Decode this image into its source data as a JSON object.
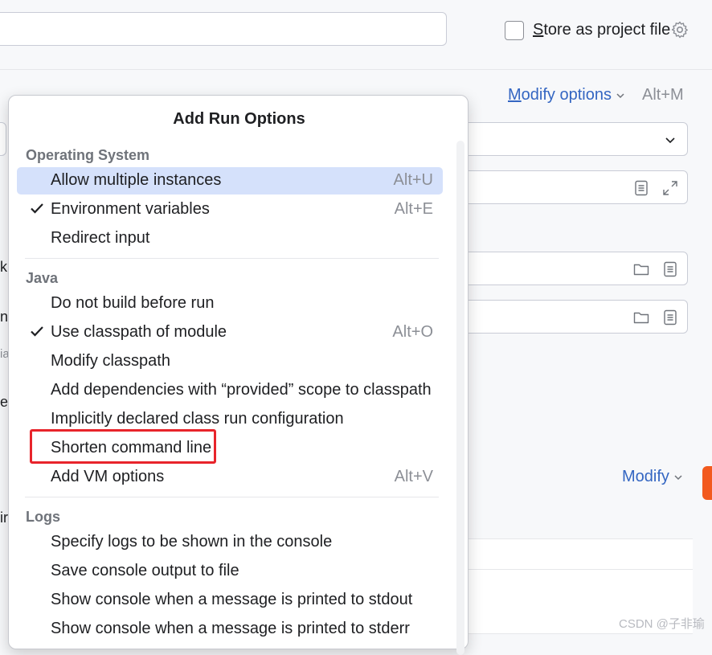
{
  "dialog": {
    "store_label_u": "S",
    "store_label_rest": "tore as project file",
    "modify_options_u": "M",
    "modify_options_rest": "odify options",
    "modify_options_shortcut": "Alt+M",
    "modify_label": "Modify",
    "left_fragments": [
      "k",
      "n",
      "ia",
      "e",
      "ir"
    ]
  },
  "popup": {
    "title": "Add Run Options",
    "sections": [
      {
        "header": "Operating System",
        "items": [
          {
            "label": "Allow multiple instances",
            "shortcut": "Alt+U",
            "checked": false,
            "highlighted": true
          },
          {
            "label": "Environment variables",
            "shortcut": "Alt+E",
            "checked": true,
            "highlighted": false
          },
          {
            "label": "Redirect input",
            "shortcut": "",
            "checked": false,
            "highlighted": false
          }
        ]
      },
      {
        "header": "Java",
        "items": [
          {
            "label": "Do not build before run",
            "shortcut": "",
            "checked": false
          },
          {
            "label": "Use classpath of module",
            "shortcut": "Alt+O",
            "checked": true
          },
          {
            "label": "Modify classpath",
            "shortcut": "",
            "checked": false
          },
          {
            "label": "Add dependencies with “provided” scope to classpath",
            "shortcut": "",
            "checked": false
          },
          {
            "label": "Implicitly declared class run configuration",
            "shortcut": "",
            "checked": false
          },
          {
            "label": "Shorten command line",
            "shortcut": "",
            "checked": false,
            "annotated": true
          },
          {
            "label": "Add VM options",
            "shortcut": "Alt+V",
            "checked": false
          }
        ]
      },
      {
        "header": "Logs",
        "items": [
          {
            "label": "Specify logs to be shown in the console",
            "shortcut": ""
          },
          {
            "label": "Save console output to file",
            "shortcut": ""
          },
          {
            "label": "Show console when a message is printed to stdout",
            "shortcut": ""
          },
          {
            "label": "Show console when a message is printed to stderr",
            "shortcut": ""
          }
        ]
      }
    ]
  },
  "watermark": "CSDN @子非瑜",
  "colors": {
    "accent": "#3466c2",
    "highlight": "#d5e1fb",
    "annotation": "#e8242b"
  }
}
